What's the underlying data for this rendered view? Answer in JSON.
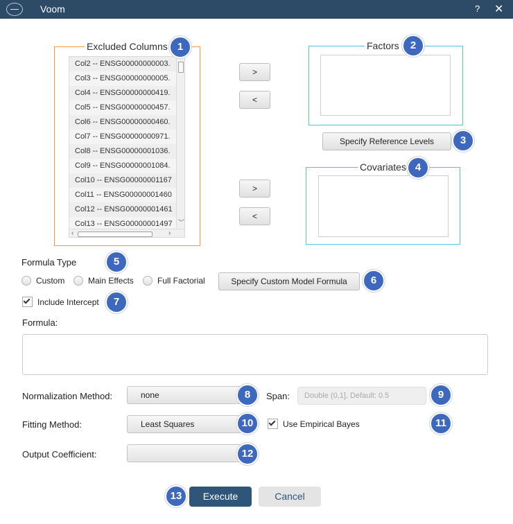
{
  "window": {
    "title": "Voom",
    "help_glyph": "?",
    "close_glyph": "✕"
  },
  "excluded_columns": {
    "label": "Excluded Columns",
    "items": [
      "Col2 -- ENSG00000000003.",
      "Col3 -- ENSG00000000005.",
      "Col4 -- ENSG00000000419.",
      "Col5 -- ENSG00000000457.",
      "Col6 -- ENSG00000000460.",
      "Col7 -- ENSG00000000971.",
      "Col8 -- ENSG00000001036.",
      "Col9 -- ENSG00000001084.",
      "Col10 -- ENSG00000001167",
      "Col11 -- ENSG00000001460",
      "Col12 -- ENSG00000001461",
      "Col13 -- ENSG00000001497"
    ]
  },
  "factors": {
    "label": "Factors",
    "move_right_label": ">",
    "move_left_label": "<"
  },
  "covariates": {
    "label": "Covariates",
    "move_right_label": ">",
    "move_left_label": "<"
  },
  "specify_reference_levels_label": "Specify Reference Levels",
  "formula_type": {
    "label": "Formula Type",
    "options": [
      "Custom",
      "Main Effects",
      "Full Factorial"
    ],
    "specify_custom_label": "Specify Custom Model Formula"
  },
  "include_intercept": {
    "label": "Include Intercept",
    "checked": true
  },
  "formula": {
    "label": "Formula:",
    "value": ""
  },
  "normalization": {
    "label": "Normalization Method:",
    "value": "none"
  },
  "span": {
    "label": "Span:",
    "placeholder": "Double (0,1], Default: 0.5"
  },
  "fitting": {
    "label": "Fitting Method:",
    "value": "Least Squares"
  },
  "empirical_bayes": {
    "label": "Use Empirical Bayes",
    "checked": true
  },
  "output_coefficient": {
    "label": "Output Coefficient:",
    "value": ""
  },
  "actions": {
    "execute_label": "Execute",
    "cancel_label": "Cancel"
  },
  "badges": [
    "1",
    "2",
    "3",
    "4",
    "5",
    "6",
    "7",
    "8",
    "9",
    "10",
    "11",
    "12",
    "13"
  ],
  "colors": {
    "titlebar": "#2d4a66",
    "excluded_border": "#f29a3e",
    "factors_border": "#4fc3e8",
    "badge": "#3d68bd",
    "execute": "#2f5679"
  }
}
